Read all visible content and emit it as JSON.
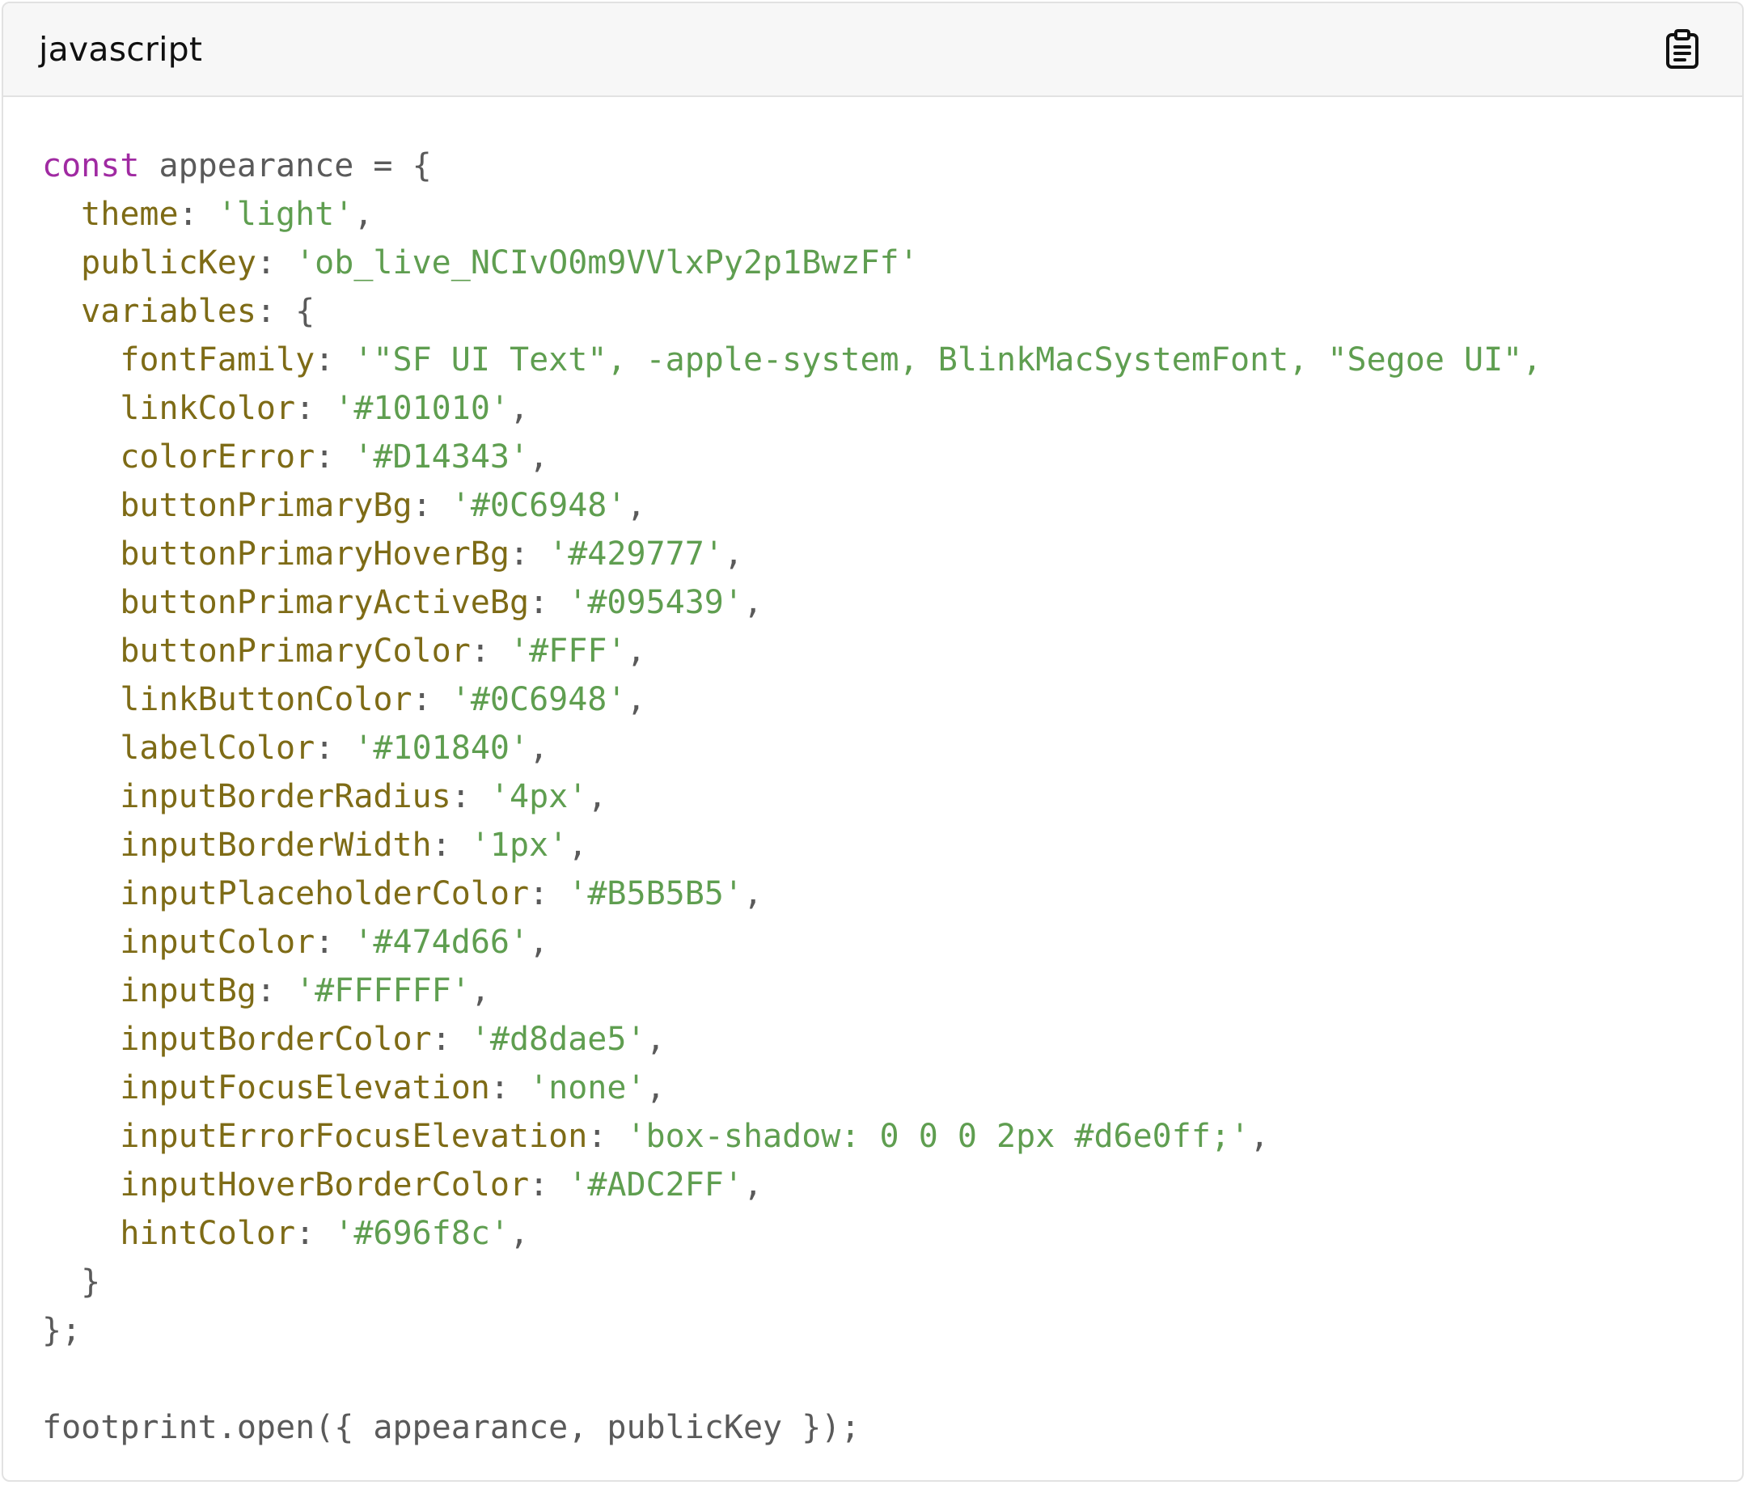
{
  "header": {
    "language": "javascript",
    "copy_icon": "clipboard-icon"
  },
  "colors": {
    "keyword": "#a02aa2",
    "property": "#7e6b16",
    "string": "#5f9e50",
    "plain": "#5a5a5a",
    "header_bg": "#f7f7f7",
    "border": "#e2e2e2"
  },
  "code": {
    "lines": [
      [
        {
          "t": "keyword",
          "v": "const"
        },
        {
          "t": "ident",
          "v": " appearance "
        },
        {
          "t": "punct",
          "v": "= {"
        }
      ],
      [
        {
          "t": "prop",
          "v": "  theme"
        },
        {
          "t": "punct",
          "v": ": "
        },
        {
          "t": "string",
          "v": "'light'"
        },
        {
          "t": "punct",
          "v": ","
        }
      ],
      [
        {
          "t": "prop",
          "v": "  publicKey"
        },
        {
          "t": "punct",
          "v": ": "
        },
        {
          "t": "string",
          "v": "'ob_live_NCIvO0m9VVlxPy2p1BwzFf'"
        }
      ],
      [
        {
          "t": "prop",
          "v": "  variables"
        },
        {
          "t": "punct",
          "v": ": {"
        }
      ],
      [
        {
          "t": "prop",
          "v": "    fontFamily"
        },
        {
          "t": "punct",
          "v": ": "
        },
        {
          "t": "string",
          "v": "'\"SF UI Text\", -apple-system, BlinkMacSystemFont, \"Segoe UI\","
        }
      ],
      [
        {
          "t": "prop",
          "v": "    linkColor"
        },
        {
          "t": "punct",
          "v": ": "
        },
        {
          "t": "string",
          "v": "'#101010'"
        },
        {
          "t": "punct",
          "v": ","
        }
      ],
      [
        {
          "t": "prop",
          "v": "    colorError"
        },
        {
          "t": "punct",
          "v": ": "
        },
        {
          "t": "string",
          "v": "'#D14343'"
        },
        {
          "t": "punct",
          "v": ","
        }
      ],
      [
        {
          "t": "prop",
          "v": "    buttonPrimaryBg"
        },
        {
          "t": "punct",
          "v": ": "
        },
        {
          "t": "string",
          "v": "'#0C6948'"
        },
        {
          "t": "punct",
          "v": ","
        }
      ],
      [
        {
          "t": "prop",
          "v": "    buttonPrimaryHoverBg"
        },
        {
          "t": "punct",
          "v": ": "
        },
        {
          "t": "string",
          "v": "'#429777'"
        },
        {
          "t": "punct",
          "v": ","
        }
      ],
      [
        {
          "t": "prop",
          "v": "    buttonPrimaryActiveBg"
        },
        {
          "t": "punct",
          "v": ": "
        },
        {
          "t": "string",
          "v": "'#095439'"
        },
        {
          "t": "punct",
          "v": ","
        }
      ],
      [
        {
          "t": "prop",
          "v": "    buttonPrimaryColor"
        },
        {
          "t": "punct",
          "v": ": "
        },
        {
          "t": "string",
          "v": "'#FFF'"
        },
        {
          "t": "punct",
          "v": ","
        }
      ],
      [
        {
          "t": "prop",
          "v": "    linkButtonColor"
        },
        {
          "t": "punct",
          "v": ": "
        },
        {
          "t": "string",
          "v": "'#0C6948'"
        },
        {
          "t": "punct",
          "v": ","
        }
      ],
      [
        {
          "t": "prop",
          "v": "    labelColor"
        },
        {
          "t": "punct",
          "v": ": "
        },
        {
          "t": "string",
          "v": "'#101840'"
        },
        {
          "t": "punct",
          "v": ","
        }
      ],
      [
        {
          "t": "prop",
          "v": "    inputBorderRadius"
        },
        {
          "t": "punct",
          "v": ": "
        },
        {
          "t": "string",
          "v": "'4px'"
        },
        {
          "t": "punct",
          "v": ","
        }
      ],
      [
        {
          "t": "prop",
          "v": "    inputBorderWidth"
        },
        {
          "t": "punct",
          "v": ": "
        },
        {
          "t": "string",
          "v": "'1px'"
        },
        {
          "t": "punct",
          "v": ","
        }
      ],
      [
        {
          "t": "prop",
          "v": "    inputPlaceholderColor"
        },
        {
          "t": "punct",
          "v": ": "
        },
        {
          "t": "string",
          "v": "'#B5B5B5'"
        },
        {
          "t": "punct",
          "v": ","
        }
      ],
      [
        {
          "t": "prop",
          "v": "    inputColor"
        },
        {
          "t": "punct",
          "v": ": "
        },
        {
          "t": "string",
          "v": "'#474d66'"
        },
        {
          "t": "punct",
          "v": ","
        }
      ],
      [
        {
          "t": "prop",
          "v": "    inputBg"
        },
        {
          "t": "punct",
          "v": ": "
        },
        {
          "t": "string",
          "v": "'#FFFFFF'"
        },
        {
          "t": "punct",
          "v": ","
        }
      ],
      [
        {
          "t": "prop",
          "v": "    inputBorderColor"
        },
        {
          "t": "punct",
          "v": ": "
        },
        {
          "t": "string",
          "v": "'#d8dae5'"
        },
        {
          "t": "punct",
          "v": ","
        }
      ],
      [
        {
          "t": "prop",
          "v": "    inputFocusElevation"
        },
        {
          "t": "punct",
          "v": ": "
        },
        {
          "t": "string",
          "v": "'none'"
        },
        {
          "t": "punct",
          "v": ","
        }
      ],
      [
        {
          "t": "prop",
          "v": "    inputErrorFocusElevation"
        },
        {
          "t": "punct",
          "v": ": "
        },
        {
          "t": "string",
          "v": "'box-shadow: 0 0 0 2px #d6e0ff;'"
        },
        {
          "t": "punct",
          "v": ","
        }
      ],
      [
        {
          "t": "prop",
          "v": "    inputHoverBorderColor"
        },
        {
          "t": "punct",
          "v": ": "
        },
        {
          "t": "string",
          "v": "'#ADC2FF'"
        },
        {
          "t": "punct",
          "v": ","
        }
      ],
      [
        {
          "t": "prop",
          "v": "    hintColor"
        },
        {
          "t": "punct",
          "v": ": "
        },
        {
          "t": "string",
          "v": "'#696f8c'"
        },
        {
          "t": "punct",
          "v": ","
        }
      ],
      [
        {
          "t": "punct",
          "v": "  }"
        }
      ],
      [
        {
          "t": "punct",
          "v": "};"
        }
      ],
      [],
      [
        {
          "t": "ident",
          "v": "footprint.open({ appearance, publicKey });"
        }
      ]
    ]
  }
}
